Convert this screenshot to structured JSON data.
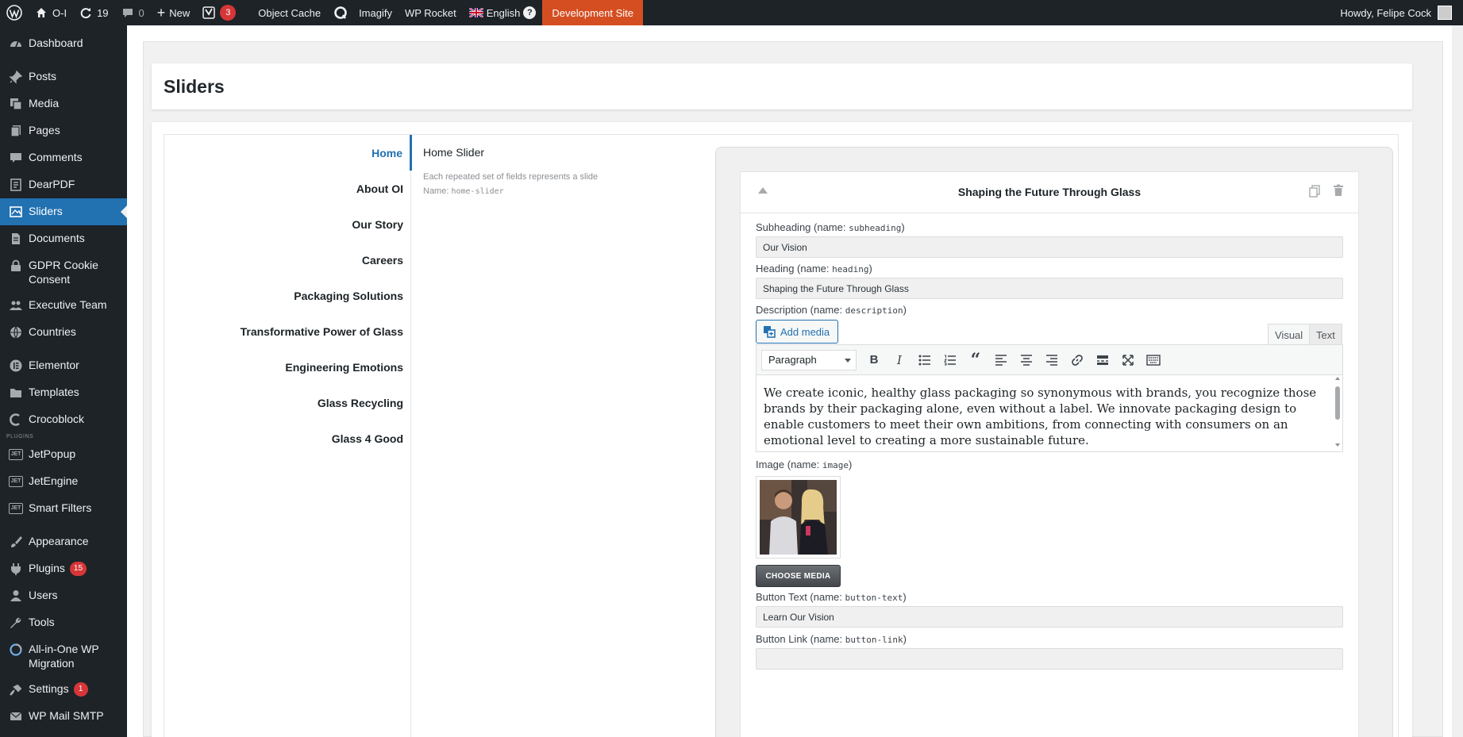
{
  "adminbar": {
    "site_name": "O-I",
    "updates_count": "19",
    "comments_count": "0",
    "new_label": "New",
    "yoast_badge": "3",
    "object_cache": "Object Cache",
    "imagify": "Imagify",
    "wp_rocket": "WP Rocket",
    "language": "English",
    "dev_site": "Development Site",
    "howdy": "Howdy, Felipe Cock"
  },
  "sidebar": {
    "items": [
      {
        "label": "Dashboard"
      },
      {
        "label": "Posts"
      },
      {
        "label": "Media"
      },
      {
        "label": "Pages"
      },
      {
        "label": "Comments"
      },
      {
        "label": "DearPDF"
      },
      {
        "label": "Sliders"
      },
      {
        "label": "Documents"
      },
      {
        "label": "GDPR Cookie Consent"
      },
      {
        "label": "Executive Team"
      },
      {
        "label": "Countries"
      },
      {
        "label": "Elementor"
      },
      {
        "label": "Templates"
      },
      {
        "label": "Crocoblock"
      },
      {
        "label": "JetPopup"
      },
      {
        "label": "JetEngine"
      },
      {
        "label": "Smart Filters"
      },
      {
        "label": "Appearance"
      },
      {
        "label": "Plugins",
        "badge": "15"
      },
      {
        "label": "Users"
      },
      {
        "label": "Tools"
      },
      {
        "label": "All-in-One WP Migration"
      },
      {
        "label": "Settings",
        "badge": "1"
      },
      {
        "label": "WP Mail SMTP"
      }
    ],
    "plugins_label": "PLUGINS"
  },
  "page": {
    "title": "Sliders"
  },
  "tabs": [
    "Home",
    "About OI",
    "Our Story",
    "Careers",
    "Packaging Solutions",
    "Transformative Power of Glass",
    "Engineering Emotions",
    "Glass Recycling",
    "Glass 4 Good"
  ],
  "field": {
    "title": "Home Slider",
    "description": "Each repeated set of fields represents a slide",
    "name_prefix": "Name:",
    "name_code": "home-slider"
  },
  "slide": {
    "title": "Shaping the Future Through Glass",
    "subheading_label": "Subheading (name:",
    "subheading_code": "subheading",
    "subheading_value": "Our Vision",
    "heading_label": "Heading (name:",
    "heading_code": "heading",
    "heading_value": "Shaping the Future Through Glass",
    "description_label": "Description (name:",
    "description_code": "description",
    "add_media": "Add media",
    "tab_visual": "Visual",
    "tab_text": "Text",
    "format": "Paragraph",
    "description_value": "We create iconic, healthy glass packaging so synonymous with brands, you recognize those brands by their packaging alone, even without a label. We innovate packaging design to enable customers to meet their own ambitions, from connecting with consumers on an emotional level to creating a more sustainable future.",
    "image_label": "Image (name:",
    "image_code": "image",
    "choose_media": "CHOOSE MEDIA",
    "button_text_label": "Button Text (name:",
    "button_text_code": "button-text",
    "button_text_value": "Learn Our Vision",
    "button_link_label": "Button Link (name:",
    "button_link_code": "button-link",
    "close_paren": ")"
  }
}
